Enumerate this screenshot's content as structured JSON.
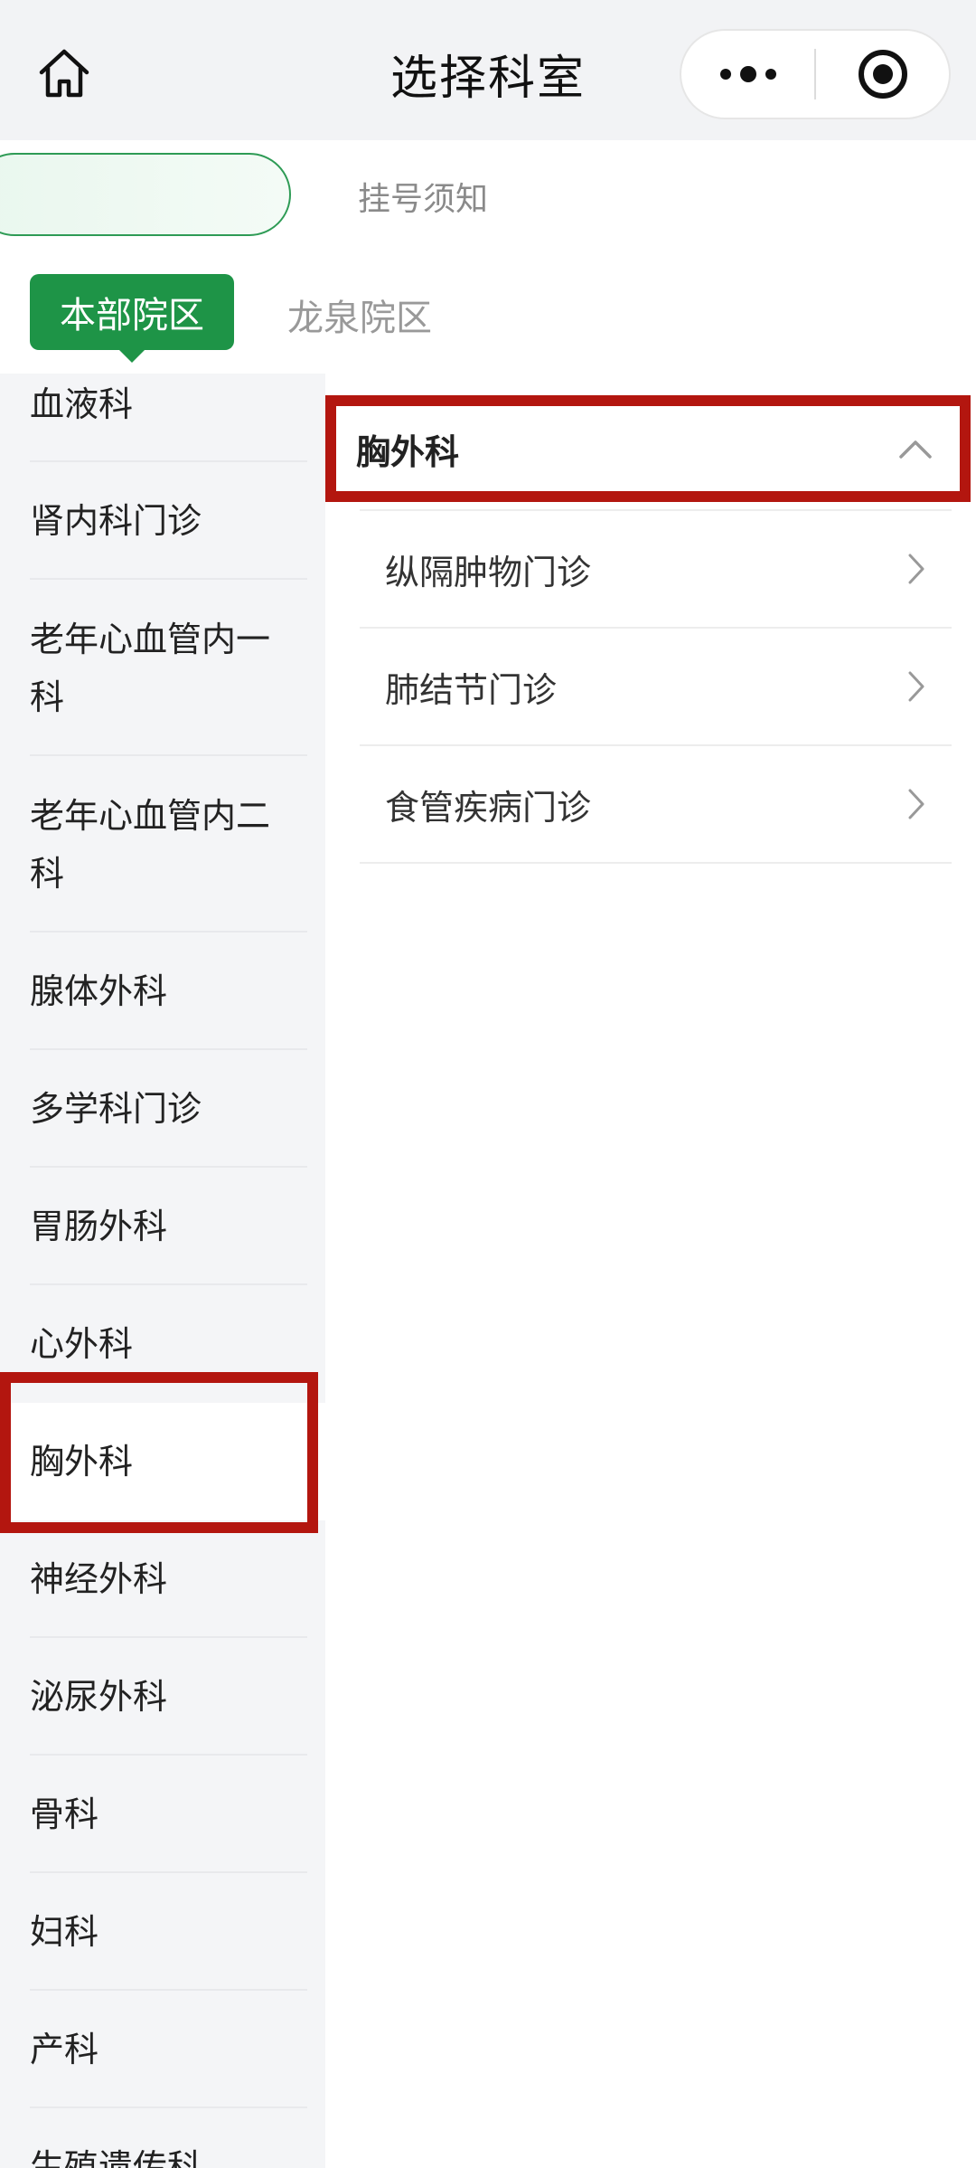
{
  "nav": {
    "title": "选择科室",
    "icons": {
      "home": "home-icon",
      "more": "more-dots-icon",
      "close": "target-close-icon"
    }
  },
  "notice": {
    "link_label": "挂号须知"
  },
  "campus_tabs": [
    {
      "label": "本部院区",
      "active": true
    },
    {
      "label": "龙泉院区",
      "active": false
    }
  ],
  "departments": [
    {
      "label": "血液科"
    },
    {
      "label": "肾内科门诊"
    },
    {
      "label": "老年心血管内一科"
    },
    {
      "label": "老年心血管内二科"
    },
    {
      "label": "腺体外科"
    },
    {
      "label": "多学科门诊"
    },
    {
      "label": "胃肠外科"
    },
    {
      "label": "心外科"
    },
    {
      "label": "胸外科",
      "selected": true
    },
    {
      "label": "神经外科"
    },
    {
      "label": "泌尿外科"
    },
    {
      "label": "骨科"
    },
    {
      "label": "妇科"
    },
    {
      "label": "产科"
    },
    {
      "label": "生殖遗传科"
    }
  ],
  "selected_group": {
    "label": "胸外科",
    "expanded": true,
    "icon": "chevron-up-icon",
    "clinics": [
      {
        "label": "纵隔肿物门诊",
        "icon": "chevron-right-icon"
      },
      {
        "label": "肺结节门诊",
        "icon": "chevron-right-icon"
      },
      {
        "label": "食管疾病门诊",
        "icon": "chevron-right-icon"
      }
    ]
  },
  "colors": {
    "brand_green": "#1e9447",
    "highlight_red": "#b3160f",
    "sidebar_bg": "#f4f5f7"
  }
}
